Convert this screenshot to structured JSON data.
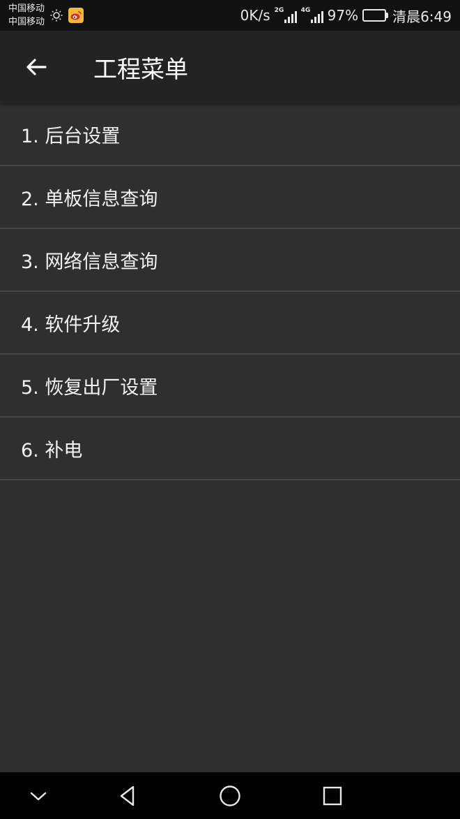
{
  "status_bar": {
    "carrier_1": "中国移动",
    "carrier_2": "中国移动",
    "net_speed": "0K/s",
    "sim1_network": "2G",
    "sim2_network": "4G",
    "battery_percent": "97%",
    "battery_level": 0.97,
    "time": "清晨6:49",
    "icons": [
      "sun-icon",
      "weibo-icon",
      "signal-icon",
      "battery-icon"
    ]
  },
  "app_bar": {
    "title": "工程菜单",
    "back_icon": "arrow-left-icon"
  },
  "menu": {
    "items": [
      {
        "label": "1. 后台设置"
      },
      {
        "label": "2. 单板信息查询"
      },
      {
        "label": "3. 网络信息查询"
      },
      {
        "label": "4. 软件升级"
      },
      {
        "label": "5. 恢复出厂设置"
      },
      {
        "label": "6. 补电"
      }
    ]
  },
  "nav_bar": {
    "icons": [
      "chevron-down-icon",
      "back-triangle-icon",
      "home-circle-icon",
      "recents-square-icon"
    ]
  },
  "colors": {
    "background": "#2f2f2f",
    "app_bar": "#232323",
    "status_bar": "#111111",
    "divider": "#474747",
    "text": "#ffffff"
  }
}
